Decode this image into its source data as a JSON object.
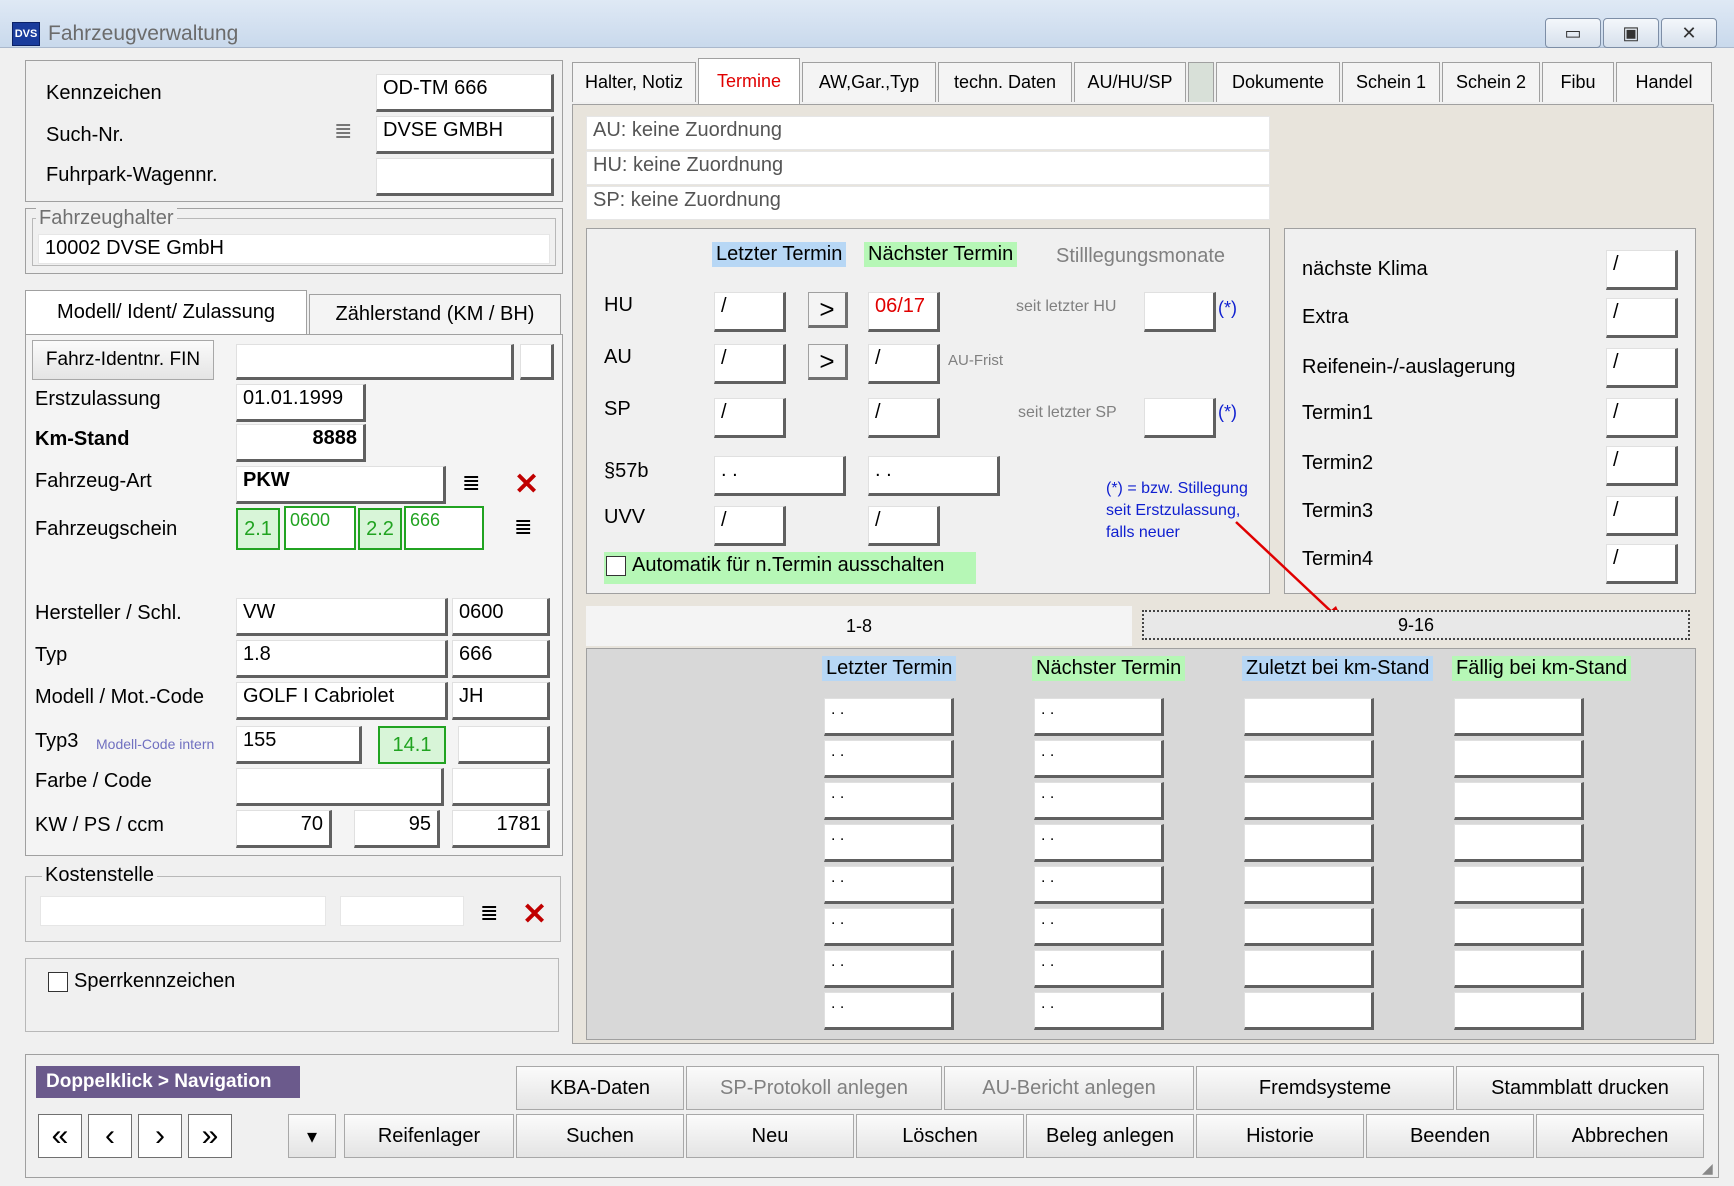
{
  "window": {
    "title": "Fahrzeugverwaltung",
    "icon_text": "DVS",
    "min": "▭",
    "max": "▣",
    "close": "✕"
  },
  "top": {
    "kennzeichen_label": "Kennzeichen",
    "kennzeichen_value": "OD-TM 666",
    "suchnr_label": "Such-Nr.",
    "suchnr_value": "DVSE GMBH",
    "fuhrpark_label": "Fuhrpark-Wagennr.",
    "fuhrpark_value": ""
  },
  "halter": {
    "legend": "Fahrzeughalter",
    "value": "10002 DVSE GmbH"
  },
  "left_tabs": {
    "tab1": "Modell/ Ident/ Zulassung",
    "tab2": "Zählerstand (KM / BH)"
  },
  "vehicle": {
    "fin_button": "Fahrz-Identnr. FIN",
    "fin_value": "",
    "erstzulassung_label": "Erstzulassung",
    "erstzulassung_value": "01.01.1999",
    "kmstand_label": "Km-Stand",
    "kmstand_value": "8888",
    "art_label": "Fahrzeug-Art",
    "art_value": "PKW",
    "schein_label": "Fahrzeugschein",
    "schein_21": "2.1",
    "schein_21_value": "0600",
    "schein_22": "2.2",
    "schein_22_value": "666",
    "hersteller_label": "Hersteller / Schl.",
    "hersteller_value": "VW",
    "hersteller_code": "0600",
    "typ_label": "Typ",
    "typ_value": "1.8",
    "typ_code": "666",
    "modell_label": "Modell / Mot.-Code",
    "modell_value": "GOLF I Cabriolet",
    "modell_code": "JH",
    "typ3_label": "Typ3",
    "typ3_hint": "Modell-Code intern",
    "typ3_value": "155",
    "typ3_code": "14.1",
    "farbe_label": "Farbe / Code",
    "kw_label": "KW / PS / ccm",
    "kw_value": "70",
    "ps_value": "95",
    "ccm_value": "1781"
  },
  "kostenstelle": {
    "legend": "Kostenstelle"
  },
  "sperr": {
    "label": "Sperrkennzeichen"
  },
  "tabs": [
    "Halter, Notiz",
    "Termine",
    "AW,Gar.,Typ",
    "techn. Daten",
    "AU/HU/SP",
    "",
    "Dokumente",
    "Schein 1",
    "Schein 2",
    "Fibu",
    "Handel"
  ],
  "assign": {
    "au": "AU: keine Zuordnung",
    "hu": "HU: keine Zuordnung",
    "sp": "SP: keine Zuordnung"
  },
  "termine": {
    "letzter": "Letzter Termin",
    "naechster": "Nächster Termin",
    "stilllegung": "Stilllegungsmonate",
    "hu_label": "HU",
    "hu_last": "/",
    "hu_next": "06/17",
    "hu_since_label": "seit letzter HU",
    "hu_star": "(*)",
    "au_label": "AU",
    "au_last": "/",
    "au_next": "/",
    "au_frist": "AU-Frist",
    "sp_label": "SP",
    "sp_last": "/",
    "sp_next": "/",
    "sp_since_label": "seit letzter SP",
    "sp_star": "(*)",
    "p57_label": "§57b",
    "p57_last": ". .",
    "p57_next": ". .",
    "uvv_label": "UVV",
    "uvv_last": "/",
    "uvv_next": "/",
    "auto_label": "Automatik für n.Termin ausschalten",
    "note": "(*) = bzw. Stillegung seit Erstzulassung, falls neuer",
    "arrow": ">"
  },
  "right_panel": {
    "items": [
      {
        "label": "nächste Klima",
        "value": "/"
      },
      {
        "label": "Extra",
        "value": "/"
      },
      {
        "label": "Reifenein-/-auslagerung",
        "value": "/"
      },
      {
        "label": "Termin1",
        "value": "/"
      },
      {
        "label": "Termin2",
        "value": "/"
      },
      {
        "label": "Termin3",
        "value": "/"
      },
      {
        "label": "Termin4",
        "value": "/"
      }
    ]
  },
  "bottom_tabs": {
    "tab1": "1-8",
    "tab2": "9-16"
  },
  "grid": {
    "h1": "Letzter Termin",
    "h2": "Nächster Termin",
    "h3": "Zuletzt bei km-Stand",
    "h4": "Fällig bei km-Stand",
    "rows": [
      ". .",
      ". .",
      ". .",
      ". .",
      ". .",
      ". .",
      ". .",
      ". ."
    ]
  },
  "footer": {
    "nav_label": "Doppelklick > Navigation",
    "first": "«",
    "prev": "‹",
    "next": "›",
    "last": "»",
    "dropdown": "▾",
    "row1": [
      "KBA-Daten",
      "SP-Protokoll anlegen",
      "AU-Bericht anlegen",
      "Fremdsysteme",
      "Stammblatt drucken"
    ],
    "row2": [
      "Reifenlager",
      "Suchen",
      "Neu",
      "Löschen",
      "Beleg anlegen",
      "Historie",
      "Beenden",
      "Abbrechen"
    ]
  },
  "colors": {
    "accent_red": "#e00000",
    "note_blue": "#1020d0",
    "hdr_blue": "#b7d7f5",
    "hdr_green": "#b6f7b6",
    "nav_bg": "#6b5a8c"
  }
}
